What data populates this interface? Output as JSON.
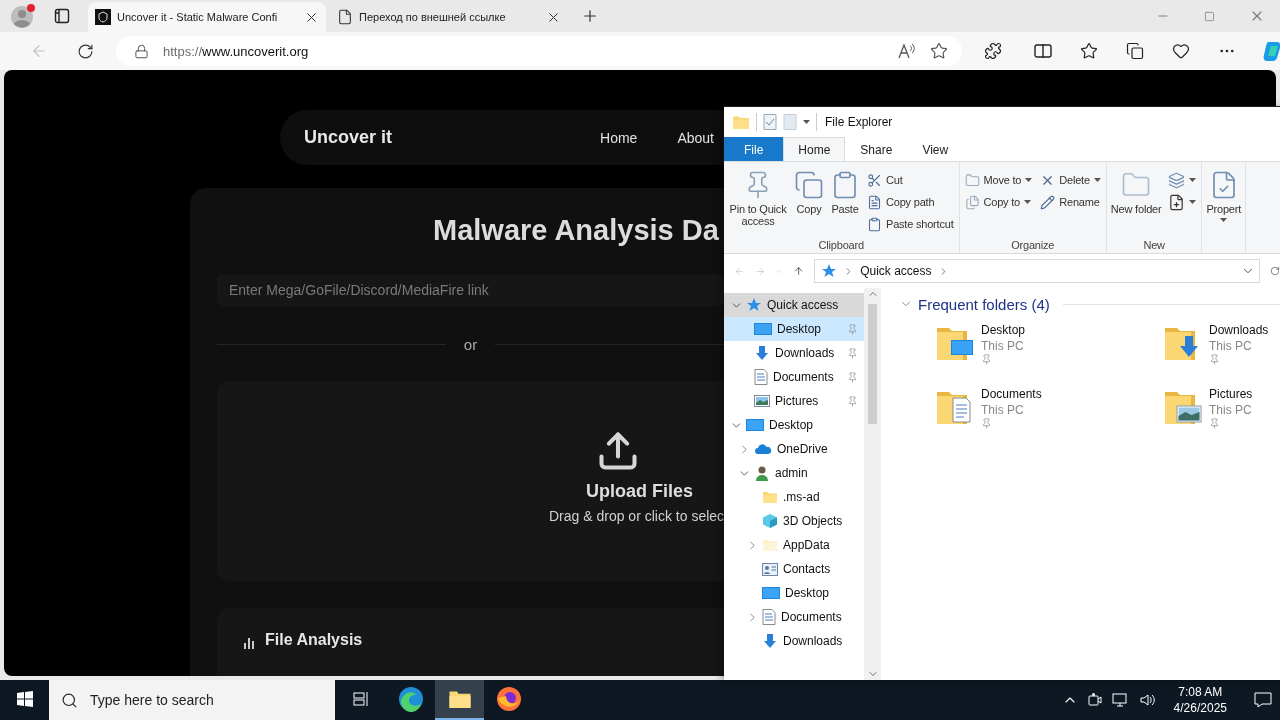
{
  "browser": {
    "tabs": [
      {
        "title": "Uncover it - Static Malware Confi",
        "kind": "site",
        "selected": true
      },
      {
        "title": "Переход по внешней ссылке",
        "kind": "page",
        "selected": false
      }
    ],
    "back": {
      "disabled": true
    },
    "address": {
      "scheme": "https://",
      "host": "www.uncoverit.org"
    }
  },
  "page": {
    "brand": "Uncover it",
    "nav": [
      "Home",
      "About"
    ],
    "title": "Malware Analysis Da",
    "link_input": {
      "placeholder": "Enter Mega/GoFile/Discord/MediaFire link"
    },
    "divider": "or",
    "upload": {
      "title": "Upload Files",
      "hint": "Drag & drop or click to selec"
    },
    "section": "File Analysis"
  },
  "explorer": {
    "title": "File Explorer",
    "ribbon_tabs": [
      {
        "label": "File",
        "kind": "menu",
        "selected": false
      },
      {
        "label": "Home",
        "kind": "tab",
        "selected": true
      },
      {
        "label": "Share",
        "kind": "tab",
        "selected": false
      },
      {
        "label": "View",
        "kind": "tab",
        "selected": false
      }
    ],
    "groups": [
      {
        "name": "Clipboard",
        "columns": [
          {
            "kind": "large",
            "items": [
              {
                "label": "Pin to Quick access",
                "kind": "pin",
                "dropdown": false
              }
            ]
          },
          {
            "kind": "large",
            "items": [
              {
                "label": "Copy",
                "kind": "copy",
                "dropdown": false
              }
            ]
          },
          {
            "kind": "large",
            "items": [
              {
                "label": "Paste",
                "kind": "paste",
                "dropdown": false
              }
            ]
          },
          {
            "kind": "small",
            "items": [
              {
                "label": "Cut",
                "kind": "cut",
                "dropdown": false
              },
              {
                "label": "Copy path",
                "kind": "copypath",
                "dropdown": false
              },
              {
                "label": "Paste shortcut",
                "kind": "shortcut",
                "dropdown": false
              }
            ]
          }
        ]
      },
      {
        "name": "Organize",
        "columns": [
          {
            "kind": "small",
            "items": [
              {
                "label": "Move to",
                "kind": "move",
                "dropdown": true
              },
              {
                "label": "Copy to",
                "kind": "copyto",
                "dropdown": true
              }
            ]
          },
          {
            "kind": "small",
            "items": [
              {
                "label": "Delete",
                "kind": "delete",
                "dropdown": true
              },
              {
                "label": "Rename",
                "kind": "rename",
                "dropdown": false
              }
            ]
          }
        ]
      },
      {
        "name": "New",
        "columns": [
          {
            "kind": "large",
            "items": [
              {
                "label": "New folder",
                "kind": "newfolder",
                "dropdown": false
              }
            ]
          },
          {
            "kind": "icons",
            "items": [
              {
                "kind": "newitem",
                "dropdown": true
              },
              {
                "kind": "easyaccess",
                "dropdown": true
              }
            ]
          }
        ]
      },
      {
        "columns": [
          {
            "kind": "large",
            "items": [
              {
                "label": "Propert",
                "kind": "properties",
                "dropdown": true
              }
            ]
          }
        ]
      }
    ],
    "back": {
      "disabled": true
    },
    "forward": {
      "disabled": true
    },
    "up": {
      "disabled": false
    },
    "path": [
      "Quick access"
    ],
    "nav": [
      {
        "label": "Quick access",
        "kind": "quick",
        "expanded": true,
        "selected": false,
        "hovered": true,
        "pinned": false,
        "children": [
          {
            "label": "Desktop",
            "kind": "desktop",
            "selected": true,
            "hovered": false,
            "pinned": true
          },
          {
            "label": "Downloads",
            "kind": "downloads",
            "selected": false,
            "hovered": false,
            "pinned": true
          },
          {
            "label": "Documents",
            "kind": "documents",
            "selected": false,
            "hovered": false,
            "pinned": true
          },
          {
            "label": "Pictures",
            "kind": "pictures",
            "selected": false,
            "hovered": false,
            "pinned": true
          }
        ]
      },
      {
        "label": "Desktop",
        "kind": "desktop",
        "expanded": true,
        "selected": false,
        "hovered": false,
        "pinned": false,
        "children": [
          {
            "label": "OneDrive",
            "kind": "onedrive",
            "expanded": false,
            "selected": false,
            "hovered": false,
            "pinned": false
          },
          {
            "label": "admin",
            "kind": "user",
            "expanded": true,
            "selected": false,
            "hovered": false,
            "pinned": false,
            "children": [
              {
                "label": ".ms-ad",
                "kind": "folder",
                "selected": false,
                "hovered": false,
                "pinned": false
              },
              {
                "label": "3D Objects",
                "kind": "cube",
                "selected": false,
                "hovered": false,
                "pinned": false
              },
              {
                "label": "AppData",
                "kind": "hidden",
                "expanded": false,
                "selected": false,
                "hovered": false,
                "pinned": false
              },
              {
                "label": "Contacts",
                "kind": "contacts",
                "selected": false,
                "hovered": false,
                "pinned": false
              },
              {
                "label": "Desktop",
                "kind": "desktop",
                "selected": false,
                "hovered": false,
                "pinned": false
              },
              {
                "label": "Documents",
                "kind": "documents",
                "expanded": false,
                "selected": false,
                "hovered": false,
                "pinned": false
              },
              {
                "label": "Downloads",
                "kind": "downloads",
                "selected": false,
                "hovered": false,
                "pinned": false
              }
            ]
          }
        ]
      }
    ],
    "section": {
      "title": "Frequent folders (4)",
      "expanded": true
    },
    "folders": [
      {
        "name": "Desktop",
        "location": "This PC",
        "kind": "desktop",
        "pinned": true
      },
      {
        "name": "Downloads",
        "location": "This PC",
        "kind": "downloads",
        "pinned": true
      },
      {
        "name": "Documents",
        "location": "This PC",
        "kind": "documents",
        "pinned": true
      },
      {
        "name": "Pictures",
        "location": "This PC",
        "kind": "pictures",
        "pinned": true
      }
    ]
  },
  "taskbar": {
    "search": {
      "placeholder": "Type here to search"
    },
    "apps": [
      {
        "kind": "taskview",
        "active": false
      },
      {
        "kind": "edge",
        "active": false
      },
      {
        "kind": "explorer",
        "active": true
      },
      {
        "kind": "firefox",
        "active": false
      }
    ],
    "time": "7:08 AM",
    "date": "4/26/2025"
  }
}
